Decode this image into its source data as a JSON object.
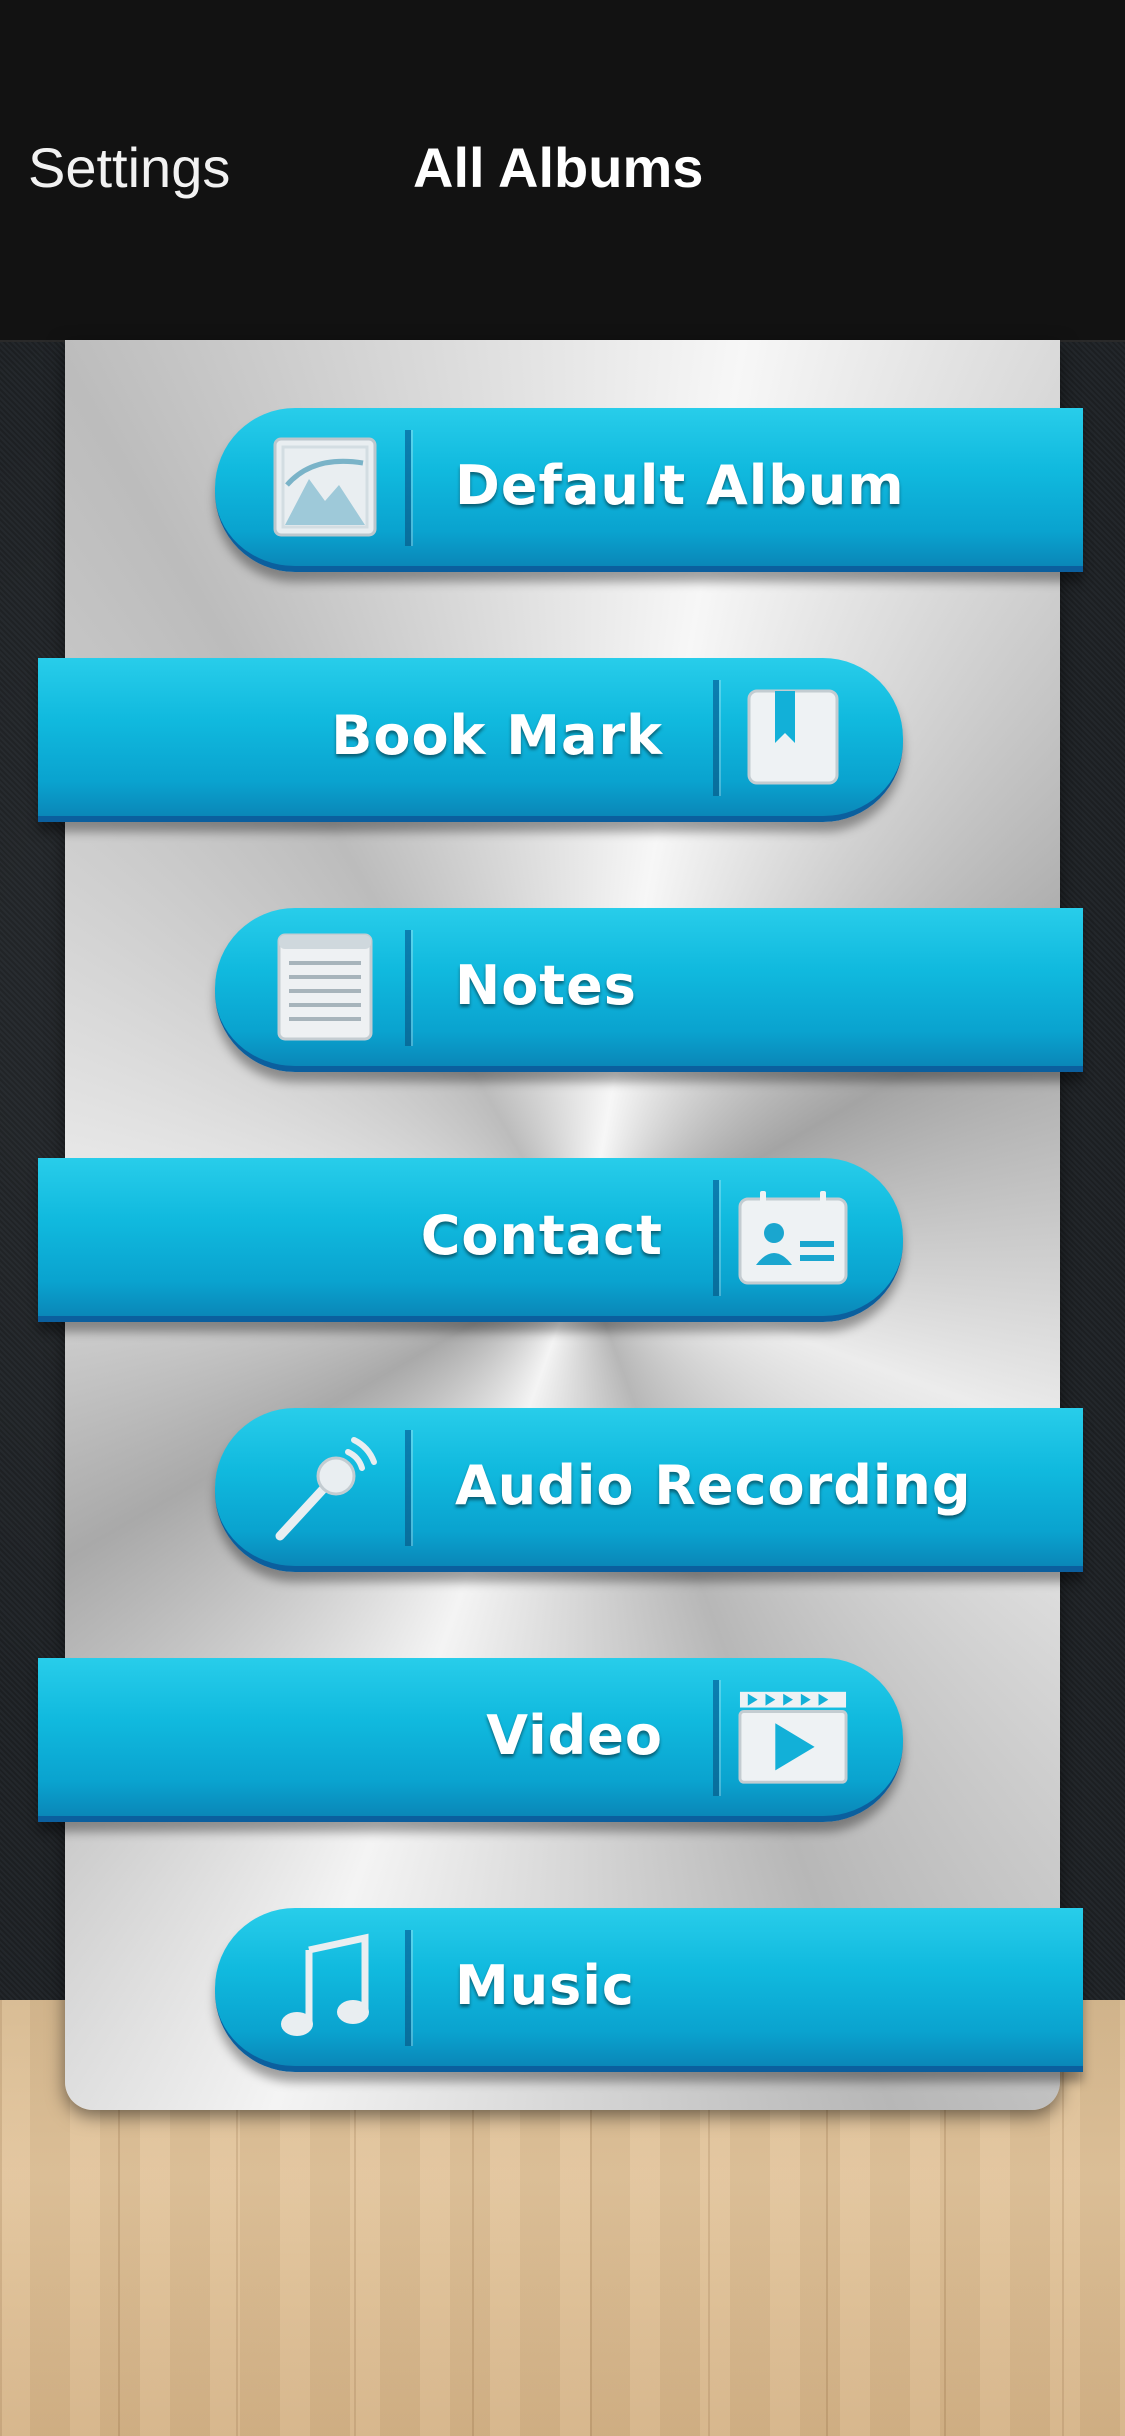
{
  "header": {
    "settings_label": "Settings",
    "title": "All Albums"
  },
  "albums": [
    {
      "label": "Default Album",
      "icon": "picture-icon"
    },
    {
      "label": "Book Mark",
      "icon": "bookmark-icon"
    },
    {
      "label": "Notes",
      "icon": "notes-icon"
    },
    {
      "label": "Contact",
      "icon": "contact-card-icon"
    },
    {
      "label": "Audio Recording",
      "icon": "microphone-icon"
    },
    {
      "label": "Video",
      "icon": "video-play-icon"
    },
    {
      "label": "Music",
      "icon": "music-note-icon"
    }
  ],
  "colors": {
    "header_bg": "#121212",
    "button_cyan": "#10b9de",
    "button_shadow": "#0b5f9e"
  }
}
